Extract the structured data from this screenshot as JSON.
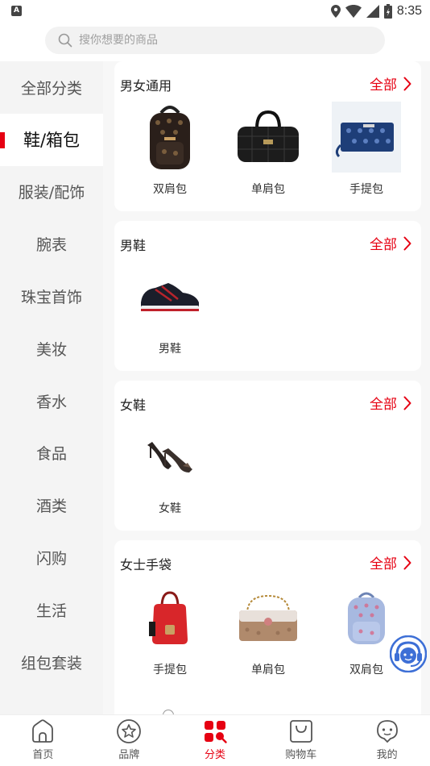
{
  "status_bar": {
    "time": "8:35",
    "left_badge": "A"
  },
  "search": {
    "placeholder": "搜你想要的商品"
  },
  "sidebar": {
    "items": [
      {
        "label": "全部分类",
        "active": false
      },
      {
        "label": "鞋/箱包",
        "active": true
      },
      {
        "label": "服装/配饰",
        "active": false
      },
      {
        "label": "腕表",
        "active": false
      },
      {
        "label": "珠宝首饰",
        "active": false
      },
      {
        "label": "美妆",
        "active": false
      },
      {
        "label": "香水",
        "active": false
      },
      {
        "label": "食品",
        "active": false
      },
      {
        "label": "酒类",
        "active": false
      },
      {
        "label": "闪购",
        "active": false
      },
      {
        "label": "生活",
        "active": false
      },
      {
        "label": "组包套装",
        "active": false
      }
    ]
  },
  "sections": [
    {
      "title": "男女通用",
      "all_label": "全部",
      "products": [
        {
          "name": "双肩包"
        },
        {
          "name": "单肩包"
        },
        {
          "name": "手提包"
        }
      ]
    },
    {
      "title": "男鞋",
      "all_label": "全部",
      "products": [
        {
          "name": "男鞋"
        }
      ]
    },
    {
      "title": "女鞋",
      "all_label": "全部",
      "products": [
        {
          "name": "女鞋"
        }
      ]
    },
    {
      "title": "女士手袋",
      "all_label": "全部",
      "products": [
        {
          "name": "手提包"
        },
        {
          "name": "单肩包"
        },
        {
          "name": "双肩包"
        }
      ]
    }
  ],
  "bottom_nav": {
    "items": [
      {
        "label": "首页",
        "icon": "home-icon",
        "active": false
      },
      {
        "label": "品牌",
        "icon": "star-icon",
        "active": false
      },
      {
        "label": "分类",
        "icon": "category-icon",
        "active": true
      },
      {
        "label": "购物车",
        "icon": "shopping-bag-icon",
        "active": false
      },
      {
        "label": "我的",
        "icon": "profile-icon",
        "active": false
      }
    ]
  },
  "colors": {
    "accent": "#e60012",
    "sidebar_bg": "#f4f4f4",
    "content_bg": "#f7f7f7"
  }
}
